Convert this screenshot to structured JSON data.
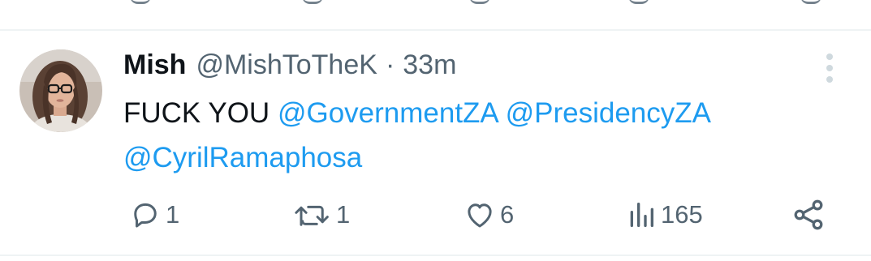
{
  "tweet": {
    "author_name": "Mish",
    "handle": "@MishToTheK",
    "separator": "·",
    "time": "33m",
    "text_prefix": "FUCK YOU ",
    "mentions": [
      "@GovernmentZA",
      "@PresidencyZA",
      "@CyrilRamaphosa"
    ]
  },
  "actions": {
    "reply_count": "1",
    "retweet_count": "1",
    "like_count": "6",
    "views_count": "165"
  },
  "colors": {
    "text": "#0f1419",
    "secondary": "#536471",
    "link": "#1d9bf0",
    "divider": "#eff3f4"
  },
  "icons": {
    "reply": "reply-icon",
    "retweet": "retweet-icon",
    "like": "heart-icon",
    "views": "views-icon",
    "share": "share-icon",
    "more": "more-vertical-icon"
  }
}
